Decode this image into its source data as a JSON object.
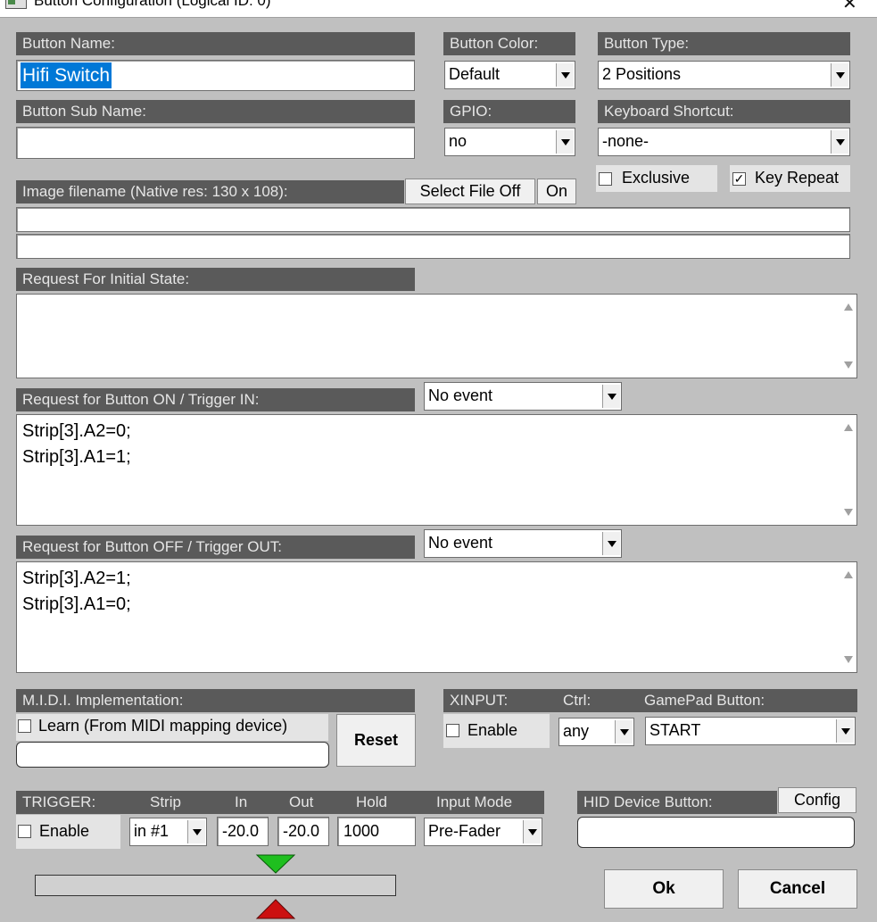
{
  "window": {
    "title": "Button Configuration (Logical ID: 0)",
    "close_glyph": "✕"
  },
  "button_name": {
    "label": "Button Name:",
    "value": "Hifi Switch"
  },
  "button_color": {
    "label": "Button Color:",
    "value": "Default"
  },
  "button_type": {
    "label": "Button Type:",
    "value": "2 Positions"
  },
  "button_sub_name": {
    "label": "Button Sub Name:",
    "value": ""
  },
  "gpio": {
    "label": "GPIO:",
    "value": "no"
  },
  "keyboard_shortcut": {
    "label": "Keyboard Shortcut:",
    "value": "-none-"
  },
  "exclusive": {
    "label": "Exclusive",
    "checked": false
  },
  "key_repeat": {
    "label": "Key Repeat",
    "checked": true,
    "check_glyph": "✓"
  },
  "image": {
    "label": "Image filename (Native res: 130 x 108):",
    "select_off": "Select File Off",
    "on": "On",
    "file_off": "",
    "file_on": ""
  },
  "initial_state": {
    "label": "Request For Initial State:",
    "text": ""
  },
  "button_on": {
    "label": "Request for Button ON / Trigger IN:",
    "event": "No event",
    "text": "Strip[3].A2=0;\nStrip[3].A1=1;"
  },
  "button_off": {
    "label": "Request for Button OFF / Trigger OUT:",
    "event": "No event",
    "text": "Strip[3].A2=1;\nStrip[3].A1=0;"
  },
  "midi": {
    "label": "M.I.D.I. Implementation:",
    "learn_label": "Learn (From MIDI mapping device)",
    "learn_checked": false,
    "reset": "Reset",
    "value": ""
  },
  "xinput": {
    "label": "XINPUT:",
    "ctrl_label": "Ctrl:",
    "gamepad_label": "GamePad Button:",
    "enable_label": "Enable",
    "enabled": false,
    "ctrl": "any",
    "gamepad": "START"
  },
  "trigger": {
    "label": "TRIGGER:",
    "strip_label": "Strip",
    "in_label": "In",
    "out_label": "Out",
    "hold_label": "Hold",
    "mode_label": "Input Mode",
    "enable_label": "Enable",
    "enabled": false,
    "strip": "in #1",
    "in": "-20.0",
    "out": "-20.0",
    "hold": "1000",
    "mode": "Pre-Fader"
  },
  "hid": {
    "label": "HID Device Button:",
    "config": "Config",
    "value": ""
  },
  "actions": {
    "ok": "Ok",
    "cancel": "Cancel"
  },
  "colors": {
    "label_bg": "#5a5a5a",
    "dialog_bg": "#c0c0c0",
    "marker_in": "#1fbf1f",
    "marker_out": "#cc1010",
    "selection": "#0078d7"
  }
}
